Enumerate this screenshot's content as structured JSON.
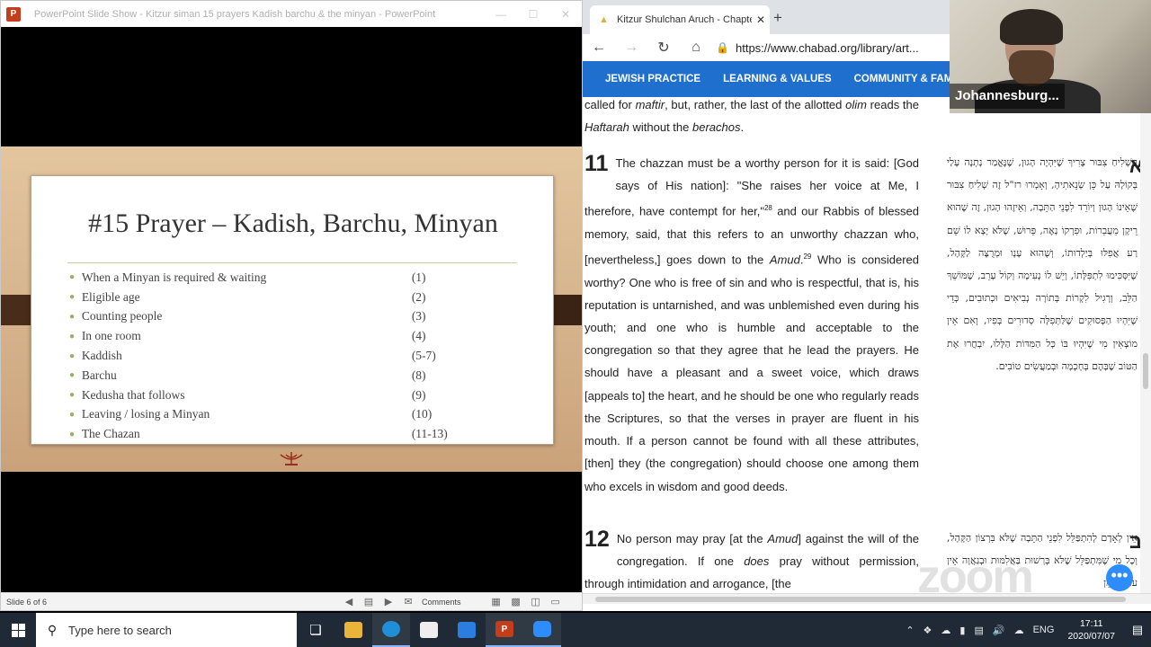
{
  "ppt": {
    "window_title": "PowerPoint Slide Show  -  Kitzur siman 15 prayers Kadish barchu & the minyan  -  PowerPoint",
    "logo_letter": "P",
    "slide": {
      "heading": "#15 Prayer – Kadish, Barchu, Minyan",
      "items": [
        {
          "text": "When a Minyan is required & waiting",
          "num": "(1)"
        },
        {
          "text": "Eligible age",
          "num": "(2)"
        },
        {
          "text": "Counting people",
          "num": "(3)"
        },
        {
          "text": "In one room",
          "num": "(4)"
        },
        {
          "text": "Kaddish",
          "num": "(5-7)"
        },
        {
          "text": "Barchu",
          "num": "(8)"
        },
        {
          "text": "Kedusha that follows",
          "num": "(9)"
        },
        {
          "text": "Leaving / losing a Minyan",
          "num": "(10)"
        },
        {
          "text": "The Chazan",
          "num": "(11-13)"
        }
      ]
    },
    "status": {
      "slide_count": "Slide 6 of 6",
      "comments": "Comments"
    }
  },
  "browser": {
    "tab_title": "Kitzur Shulchan Aruch - Chapter",
    "url": "https://www.chabad.org/library/art...",
    "nav": [
      "JEWISH PRACTICE",
      "LEARNING & VALUES",
      "COMMUNITY & FAMILY"
    ],
    "content": {
      "intro_line1": "called for ",
      "intro_maftir": "maftir",
      "intro_line2": ", but, rather, the last of the allotted ",
      "intro_olim": "olim",
      "intro_line3": " reads the ",
      "intro_haftarah": "Haftarah",
      "intro_line4": " without the ",
      "intro_berachos": "berachos",
      "intro_line5": ".",
      "sec11_num": "11",
      "sec11_a": "The chazzan must be a worthy person for it is said: [God says of His nation]: \"She raises her voice at Me, I therefore, have contempt for her,\"",
      "sec11_fn1": "28",
      "sec11_b": " and our Rabbis of blessed memory, said, that this refers to an unworthy chazzan who, [nevertheless,] goes down to the ",
      "sec11_amud": "Amud",
      "sec11_fn2": "29",
      "sec11_c": " Who is considered worthy? One who is free of sin and who is respectful, that is, his reputation is untarnished, and was unblemished even during his youth; and one who is humble and acceptable to the congregation so that they agree that he lead the prayers. He should have a pleasant and a sweet voice, which draws [appeals to] the heart, and he should be one who regularly reads the Scriptures, so that the verses in prayer are fluent in his mouth. If a person cannot be found with all these attributes, [then] they (the congregation) should choose one among them who excels in wisdom and good deeds.",
      "sec12_num": "12",
      "sec12_a": "No person may pray [at the ",
      "sec12_amud": "Amud",
      "sec12_b": "] against the will of the congregation. If one ",
      "sec12_does": "does",
      "sec12_c": " pray without permission, through intimidation and arrogance, [the",
      "he11_letter": "א",
      "he11": "הַשְׁלִיחַ צִבּוּר צָרִיךְ שֶׁיִּהְיֶה הָגוּן, שֶׁנֶּאֱמַר נָתְנָה עָלַי בְּקוֹלָהּ עַל כֵּן שְׂנֵאתִיהָ, וְאָמְרוּ רז\"ל זֶה שְׁלִיחַ צִבּוּר שֶׁאֵינוֹ הָגוּן וְיוֹרֵד לִפְנֵי הַתֵּבָה, וְאֵיזֶהוּ הָגוּן, זֶה שֶׁהוּא רֵיקָן מֵעֲבֵרוֹת, וּפִרְקוֹ נָאֶה, פֵּרוּשׁ, שֶׁלֹּא יָצָא לוֹ שֵׁם רַע אֲפִלּוּ בְּיַלְדוּתוֹ, וְשֶׁהוּא עָנָו וּמְרֻצֶּה לַקָּהָל, שֶׁיִּסְּכִּימוּ לִתְפִּלָּתוֹ, וְיֵשׁ לוֹ נְעִימָה וְקוֹל עָרֵב, שֶׁמּוֹשֵׁךְ הַלֵּב, וְרָגִיל לִקְרוֹת בְּתוֹרָה נְבִיאִים וּכְתוּבִים, כְּדֵי שֶׁיִּהְיוּ הַפְּסוּקִים שֶׁלַּתְּפִלָּה סְדוּרִים בְּפִיו, וְאִם אֵין מוֹצְאִין מִי שֶׁיִּהְיוּ בּוֹ כָּל הַמִּדּוֹת הַלָּלוּ, יִבְחֲרוּ אֶת הַטּוֹב שֶׁבָּהֶם בְּחָכְמָה וּבְמַעֲשִׂים טוֹבִים.",
      "he12_letter": "ב",
      "he12": "אֵין לְאָדָם לְהִתְפַּלֵּל לִפְנֵי הַתֵּבָה שֶׁלֹּא בִּרְצוֹן הַקָּהָל, וְכָל מִי שֶׁמִּתְפַּלֵּל שֶׁלֹּא בְּרְשׁוּת בַּאֲלִמּוּת וּבְגַאֲוָה אֵין עוֹנִין אָמֵן"
    },
    "zoom_watermark": "zoom"
  },
  "video": {
    "participant_name": "Johannesburg..."
  },
  "taskbar": {
    "search_placeholder": "Type here to search",
    "language": "ENG",
    "time": "17:11",
    "date": "2020/07/07"
  }
}
